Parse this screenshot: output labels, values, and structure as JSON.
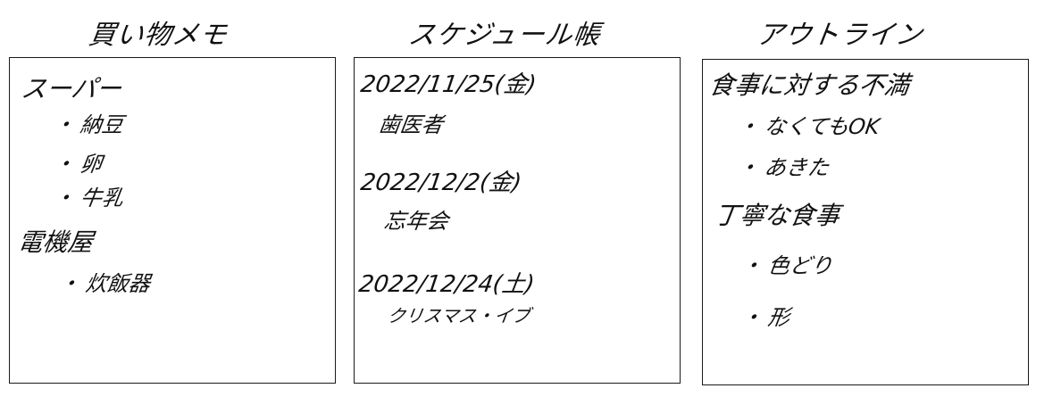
{
  "columns": {
    "shopping": {
      "title": "買い物メモ",
      "groups": [
        {
          "heading": "スーパー",
          "items": [
            "納豆",
            "卵",
            "牛乳"
          ]
        },
        {
          "heading": "電機屋",
          "items": [
            "炊飯器"
          ]
        }
      ]
    },
    "schedule": {
      "title": "スケジュール帳",
      "entries": [
        {
          "date": "2022/11/25(金)",
          "event": "歯医者"
        },
        {
          "date": "2022/12/2(金)",
          "event": "忘年会"
        },
        {
          "date": "2022/12/24(土)",
          "event": "クリスマス・イブ"
        }
      ]
    },
    "outline": {
      "title": "アウトライン",
      "sections": [
        {
          "heading": "食事に対する不満",
          "items": [
            "なくてもOK",
            "あきた"
          ]
        },
        {
          "heading": "丁寧な食事",
          "items": [
            "色どり",
            "形"
          ]
        }
      ]
    }
  },
  "bullet": "・"
}
